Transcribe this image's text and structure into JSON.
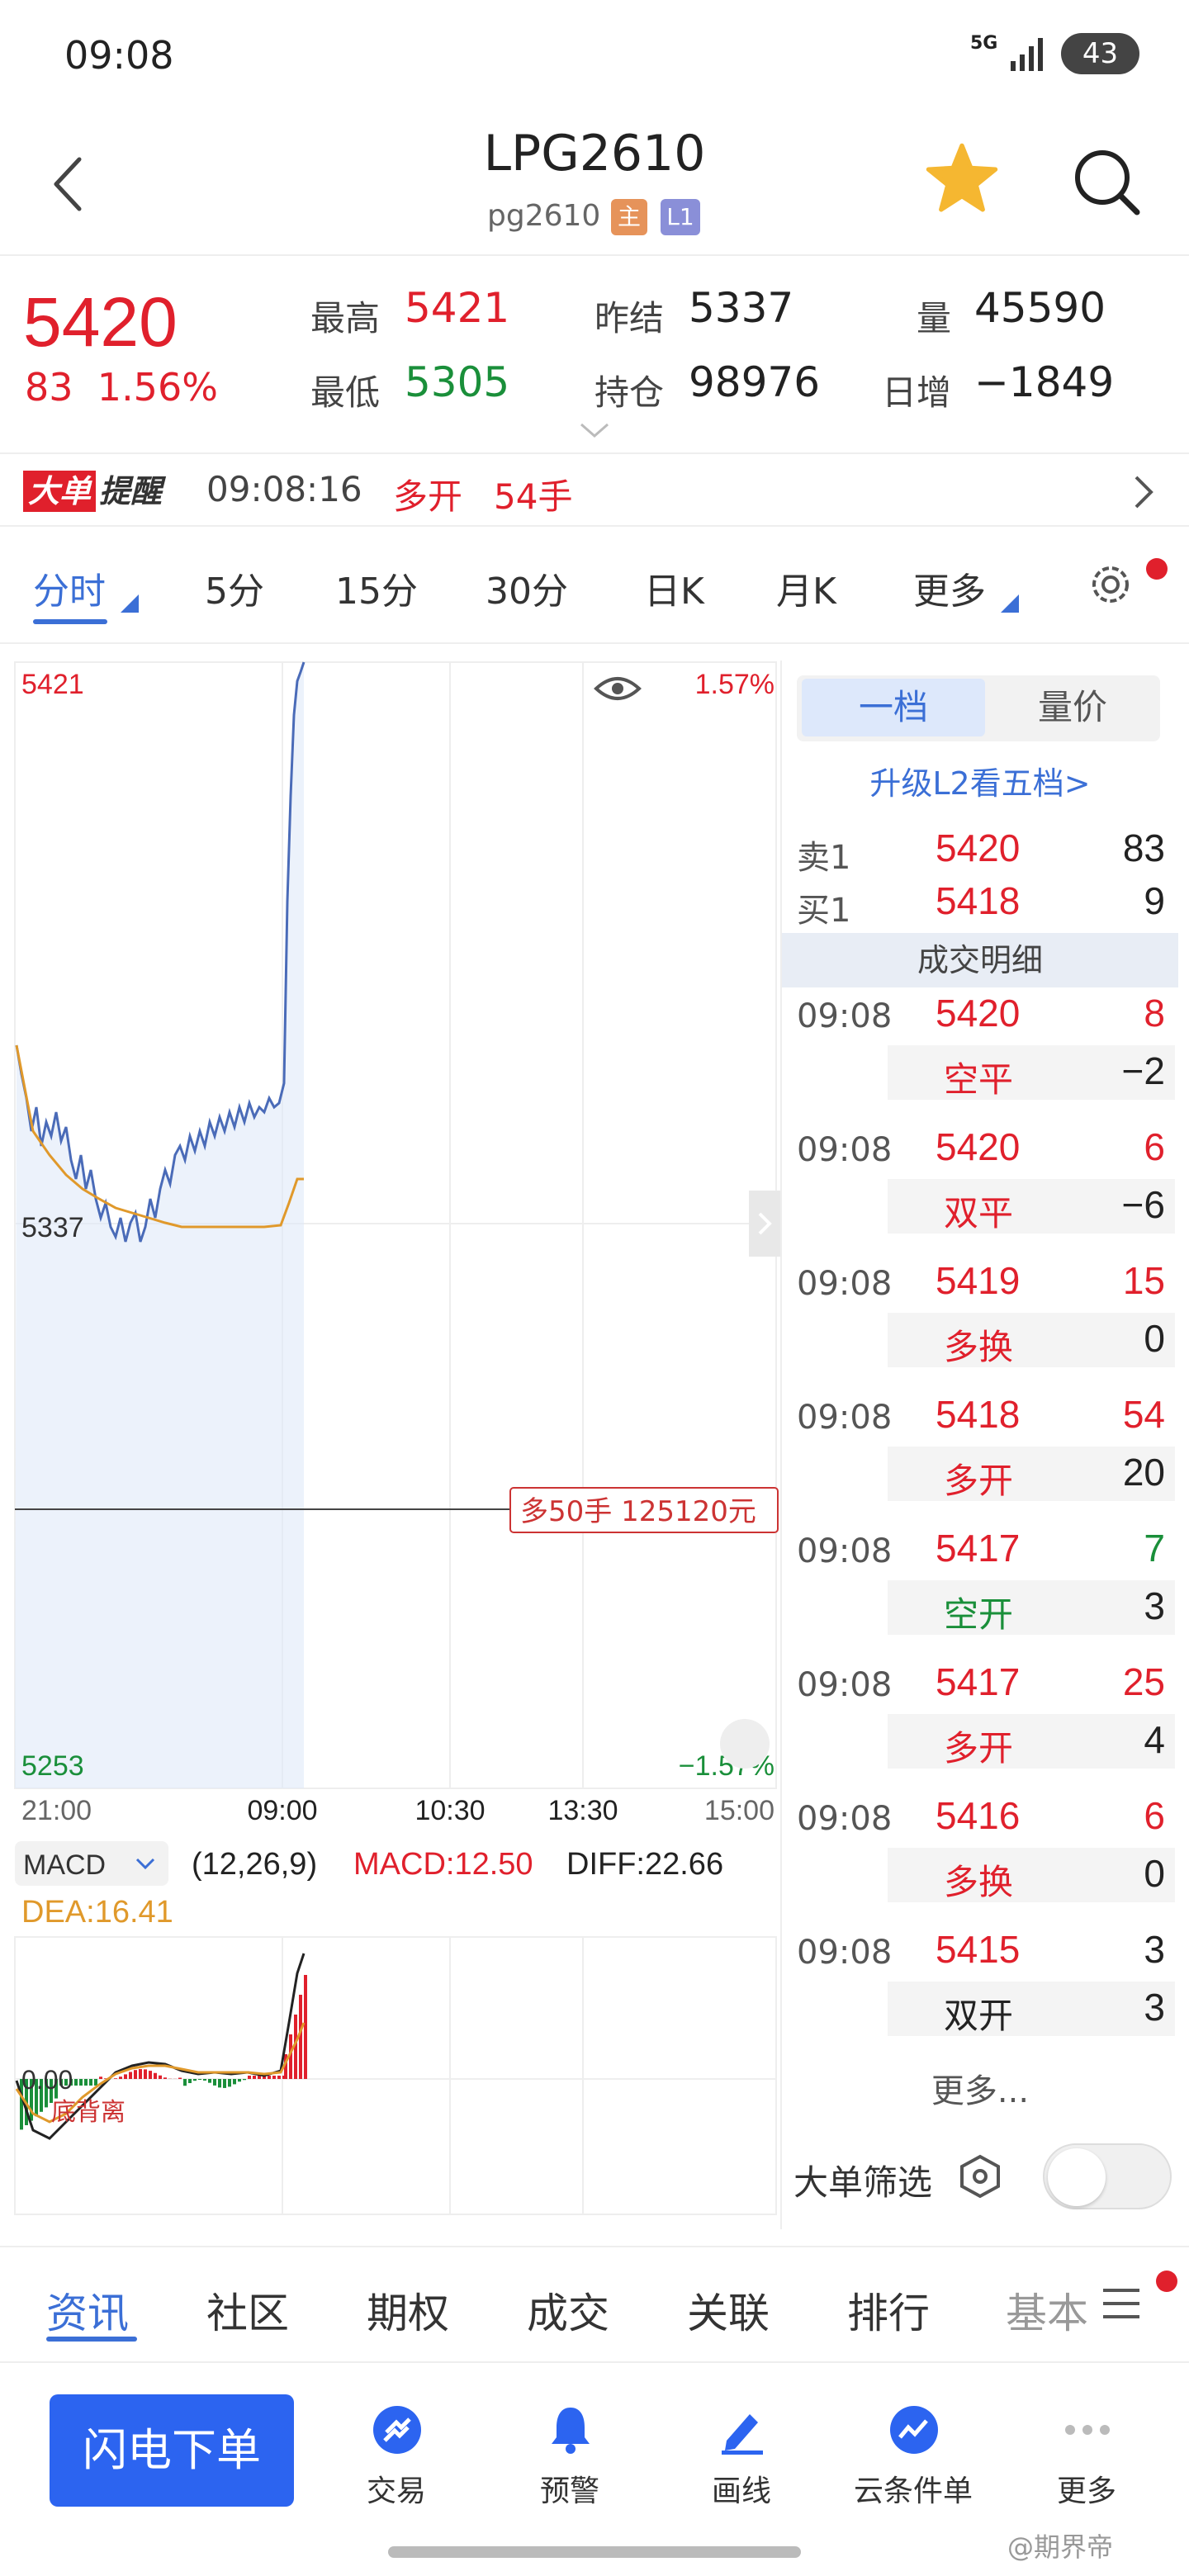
{
  "status": {
    "time": "09:08",
    "network": "5G",
    "battery": "43"
  },
  "header": {
    "title": "LPG2610",
    "code": "pg2610",
    "tag_main": "主",
    "tag_level": "L1"
  },
  "quote": {
    "last": "5420",
    "change": "83",
    "change_pct": "1.56%",
    "high_label": "最高",
    "high": "5421",
    "low_label": "最低",
    "low": "5305",
    "prev_settle_label": "昨结",
    "prev_settle": "5337",
    "open_interest_label": "持仓",
    "open_interest": "98976",
    "volume_label": "量",
    "volume": "45590",
    "daily_inc_label": "日增",
    "daily_inc": "−1849"
  },
  "alert": {
    "badge_a": "大单",
    "badge_b": "提醒",
    "time": "09:08:16",
    "dir": "多开",
    "qty": "54手"
  },
  "tabs": [
    {
      "label": "分时",
      "active": true
    },
    {
      "label": "5分"
    },
    {
      "label": "15分"
    },
    {
      "label": "30分"
    },
    {
      "label": "日K"
    },
    {
      "label": "月K"
    },
    {
      "label": "更多"
    }
  ],
  "chart": {
    "top_price": "5421",
    "top_pct": "1.57%",
    "mid_price": "5337",
    "bottom_price": "5253",
    "bottom_pct": "−1.57%",
    "times": [
      "21:00",
      "09:00",
      "10:30",
      "13:30",
      "15:00"
    ],
    "order_tag": "多50手  125120元",
    "macd_label": "MACD",
    "macd_params": "(12,26,9)",
    "macd_value": "MACD:12.50",
    "diff_value": "DIFF:22.66",
    "dea_value": "DEA:16.41",
    "macd_zero": "0.00",
    "macd_note": "底背离",
    "colors": {
      "up": "#e0202c",
      "down": "#1a8f3a",
      "price_line": "#4a6bb8",
      "avg_line": "#e0992b"
    }
  },
  "side": {
    "seg_a": "一档",
    "seg_b": "量价",
    "upgrade": "升级L2看五档>",
    "ask_label": "卖1",
    "ask_price": "5420",
    "ask_vol": "83",
    "bid_label": "买1",
    "bid_price": "5418",
    "bid_vol": "9",
    "detail_header": "成交明细",
    "trades": [
      {
        "time": "09:08",
        "price": "5420",
        "vol": "8",
        "type": "空平",
        "delta": "−2",
        "pc": "r",
        "vc": "r",
        "tc": "r"
      },
      {
        "time": "09:08",
        "price": "5420",
        "vol": "6",
        "type": "双平",
        "delta": "−6",
        "pc": "r",
        "vc": "r",
        "tc": "r"
      },
      {
        "time": "09:08",
        "price": "5419",
        "vol": "15",
        "type": "多换",
        "delta": "0",
        "pc": "r",
        "vc": "r",
        "tc": "r"
      },
      {
        "time": "09:08",
        "price": "5418",
        "vol": "54",
        "type": "多开",
        "delta": "20",
        "pc": "r",
        "vc": "r",
        "tc": "r"
      },
      {
        "time": "09:08",
        "price": "5417",
        "vol": "7",
        "type": "空开",
        "delta": "3",
        "pc": "r",
        "vc": "g",
        "tc": "g"
      },
      {
        "time": "09:08",
        "price": "5417",
        "vol": "25",
        "type": "多开",
        "delta": "4",
        "pc": "r",
        "vc": "r",
        "tc": "r"
      },
      {
        "time": "09:08",
        "price": "5416",
        "vol": "6",
        "type": "多换",
        "delta": "0",
        "pc": "r",
        "vc": "r",
        "tc": "r"
      },
      {
        "time": "09:08",
        "price": "5415",
        "vol": "3",
        "type": "双开",
        "delta": "3",
        "pc": "r",
        "vc": "k",
        "tc": "k"
      }
    ],
    "more": "更多...",
    "filter_label": "大单筛选"
  },
  "bottom_tabs": [
    "资讯",
    "社区",
    "期权",
    "成交",
    "关联",
    "排行",
    "基本"
  ],
  "actions": {
    "main": "闪电下单",
    "items": [
      {
        "label": "交易",
        "icon": "trade-icon"
      },
      {
        "label": "预警",
        "icon": "bell-icon"
      },
      {
        "label": "画线",
        "icon": "draw-icon"
      },
      {
        "label": "云条件单",
        "icon": "cloud-order-icon"
      },
      {
        "label": "更多",
        "icon": "more-dots-icon"
      }
    ]
  },
  "watermark": "@期界帝"
}
